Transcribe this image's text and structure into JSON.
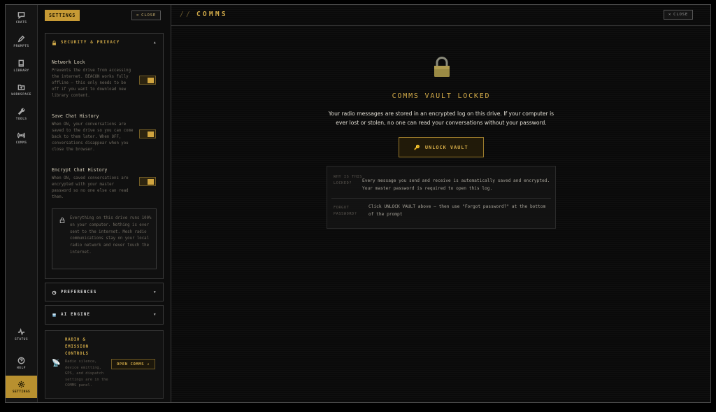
{
  "nav": {
    "items": [
      {
        "label": "CHATS",
        "icon": "chat-icon"
      },
      {
        "label": "PROMPTS",
        "icon": "pen-icon"
      },
      {
        "label": "LIBRARY",
        "icon": "book-icon"
      },
      {
        "label": "WORKSPACE",
        "icon": "folder-icon"
      },
      {
        "label": "TOOLS",
        "icon": "wrench-icon"
      },
      {
        "label": "COMMS",
        "icon": "radio-icon"
      }
    ],
    "bottom": [
      {
        "label": "STATUS",
        "icon": "pulse-icon"
      },
      {
        "label": "HELP",
        "icon": "help-icon"
      },
      {
        "label": "SETTINGS",
        "icon": "gear-icon",
        "active": true
      }
    ]
  },
  "settings": {
    "title": "SETTINGS",
    "close_label": "CLOSE",
    "security": {
      "title": "SECURITY & PRIVACY",
      "toggles": [
        {
          "title": "Network Lock",
          "desc": "Prevents the drive from accessing the internet. BEACON works fully offline — this only needs to be off if you want to download new library content.",
          "on": true
        },
        {
          "title": "Save Chat History",
          "desc": "When ON, your conversations are saved to the drive so you can come back to them later. When OFF, conversations disappear when you close the browser.",
          "on": true
        },
        {
          "title": "Encrypt Chat History",
          "desc": "When ON, saved conversations are encrypted with your master password so no one else can read them.",
          "on": true
        }
      ],
      "info": "Everything on this drive runs 100% on your computer. Nothing is ever sent to the internet. Mesh radio communications stay on your local radio network and never touch the internet."
    },
    "preferences_title": "PREFERENCES",
    "ai_engine_title": "AI ENGINE",
    "radio_card": {
      "title": "RADIO & EMISSION CONTROLS",
      "desc": "Radio silence, device emitting, GPS, and dispatch settings are in the COMMS panel.",
      "button": "OPEN COMMS →"
    }
  },
  "main": {
    "slash": "//",
    "title": "COMMS",
    "close_label": "CLOSE",
    "vault_title": "COMMS VAULT LOCKED",
    "vault_desc": "Your radio messages are stored in an encrypted log on this drive. If your computer is ever lost or stolen, no one can read your conversations without your password.",
    "unlock_label": "UNLOCK VAULT",
    "faq": [
      {
        "q": "WHY IS THIS LOCKED?",
        "a": "Every message you send and receive is automatically saved and encrypted. Your master password is required to open this log."
      },
      {
        "q": "FORGOT PASSWORD?",
        "a": "Click UNLOCK VAULT above — then use \"Forgot password?\" at the bottom of the prompt"
      }
    ]
  },
  "colors": {
    "accent": "#d0a948",
    "active_nav": "#b8902f",
    "background": "#0a0a0a"
  }
}
